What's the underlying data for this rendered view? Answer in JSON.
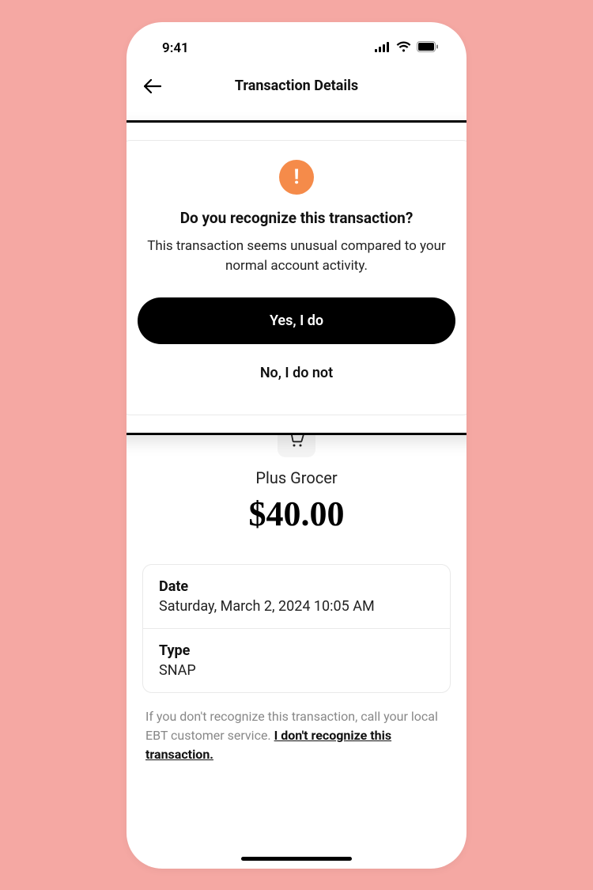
{
  "status": {
    "time": "9:41"
  },
  "nav": {
    "title": "Transaction Details"
  },
  "modal": {
    "title": "Do you recognize this transaction?",
    "desc": "This transaction seems unusual compared to your normal account activity.",
    "yes": "Yes, I do",
    "no": "No, I do not"
  },
  "transaction": {
    "merchant": "Plus Grocer",
    "amount": "$40.00",
    "dateLabel": "Date",
    "dateValue": "Saturday, March 2, 2024 10:05 AM",
    "typeLabel": "Type",
    "typeValue": "SNAP"
  },
  "footer": {
    "text": "If you don't recognize this transaction, call your local EBT customer service. ",
    "link": "I don't recognize this transaction."
  }
}
